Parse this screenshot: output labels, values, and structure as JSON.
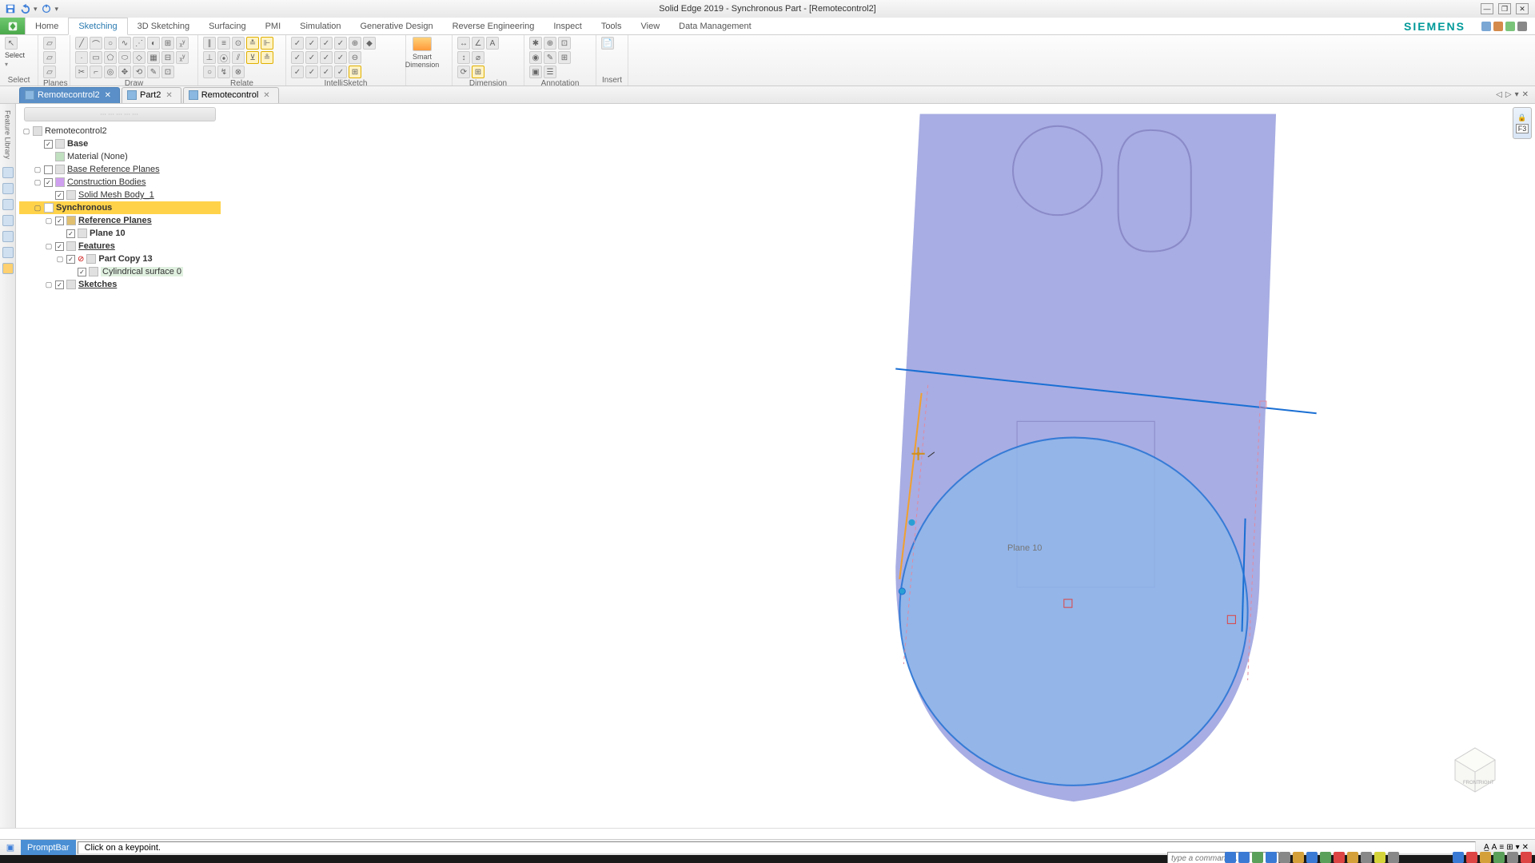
{
  "window": {
    "title": "Solid Edge 2019 - Synchronous Part - [Remotecontrol2]"
  },
  "brand": "SIEMENS",
  "tabs": {
    "items": [
      "Home",
      "Sketching",
      "3D Sketching",
      "Surfacing",
      "PMI",
      "Simulation",
      "Generative Design",
      "Reverse Engineering",
      "Inspect",
      "Tools",
      "View",
      "Data Management"
    ],
    "active": 1
  },
  "ribbon": {
    "groups": [
      "Select",
      "Planes",
      "Draw",
      "Relate",
      "IntelliSketch",
      "Smart Dimension",
      "Dimension",
      "Annotation",
      "Insert"
    ]
  },
  "documents": {
    "tabs": [
      {
        "label": "Remotecontrol2",
        "active": true
      },
      {
        "label": "Part2",
        "active": false
      },
      {
        "label": "Remotecontrol",
        "active": false
      }
    ]
  },
  "feature_library_label": "Feature Library",
  "tree": {
    "root": "Remotecontrol2",
    "base": "Base",
    "material": "Material (None)",
    "base_ref": "Base Reference Planes",
    "construction": "Construction Bodies",
    "solid_mesh": "Solid Mesh Body_1",
    "sync": "Synchronous",
    "ref_planes": "Reference Planes",
    "plane10": "Plane 10",
    "features": "Features",
    "partcopy": "Part Copy 13",
    "cylsurf": "Cylindrical surface 0",
    "sketches": "Sketches"
  },
  "canvas": {
    "plane_label": "Plane 10"
  },
  "right_lock": {
    "key": "F3"
  },
  "status": {
    "label": "PromptBar",
    "message": "Click on a keypoint."
  },
  "command_prompt": "type a command…"
}
